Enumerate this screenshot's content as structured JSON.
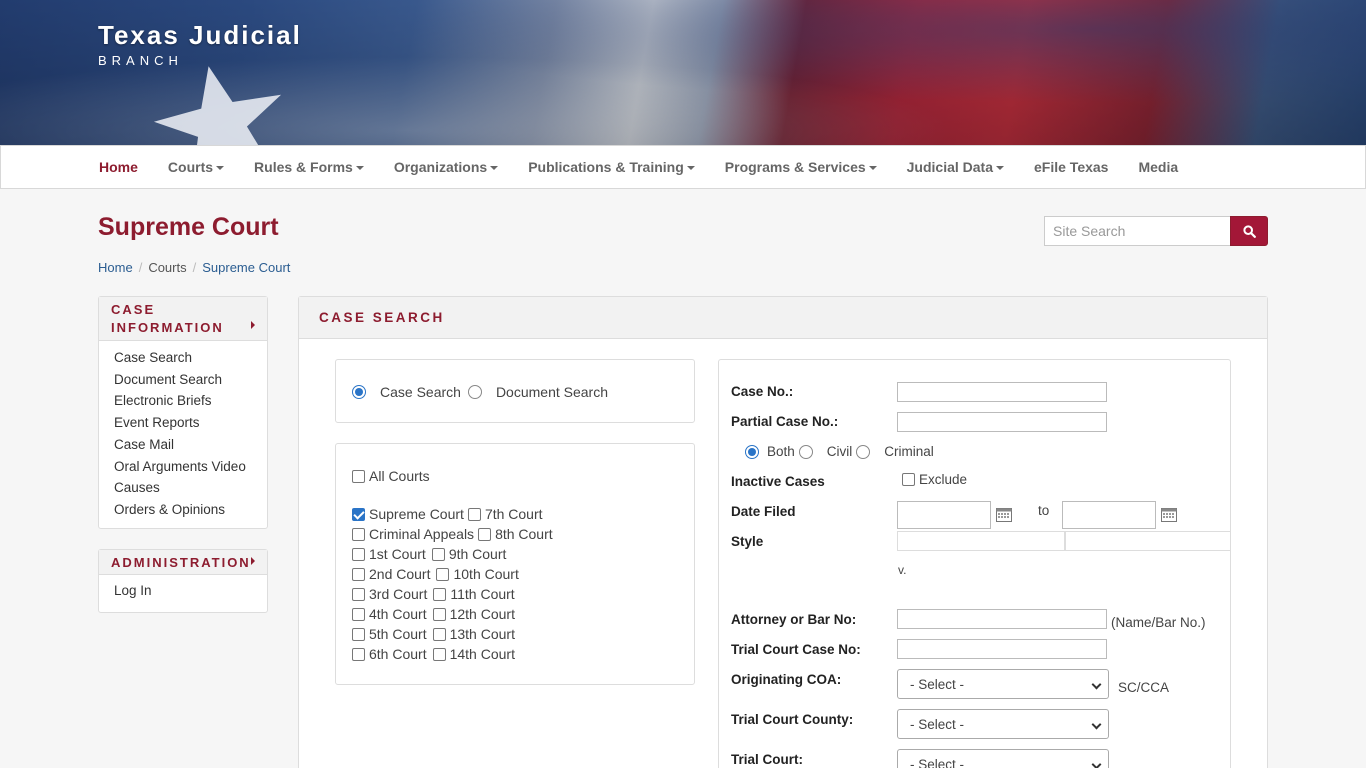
{
  "header": {
    "brand_title": "Texas Judicial",
    "brand_subtitle": "BRANCH"
  },
  "nav": {
    "items": [
      {
        "label": "Home",
        "active": true,
        "dropdown": false
      },
      {
        "label": "Courts",
        "dropdown": true
      },
      {
        "label": "Rules & Forms",
        "dropdown": true
      },
      {
        "label": "Organizations",
        "dropdown": true
      },
      {
        "label": "Publications & Training",
        "dropdown": true
      },
      {
        "label": "Programs & Services",
        "dropdown": true
      },
      {
        "label": "Judicial Data",
        "dropdown": true
      },
      {
        "label": "eFile Texas",
        "dropdown": false
      },
      {
        "label": "Media",
        "dropdown": false
      }
    ]
  },
  "page": {
    "title": "Supreme Court"
  },
  "site_search": {
    "placeholder": "Site Search"
  },
  "breadcrumb": {
    "home": "Home",
    "courts": "Courts",
    "current": "Supreme Court"
  },
  "sidebar": {
    "case_info": {
      "heading_line1": "CASE",
      "heading_line2": "INFORMATION",
      "items": [
        "Case Search",
        "Document Search",
        "Electronic Briefs",
        "Event Reports",
        "Case Mail",
        "Oral Arguments Video",
        "Causes",
        "Orders & Opinions"
      ]
    },
    "admin": {
      "heading": "ADMINISTRATION",
      "items": [
        "Log In"
      ]
    }
  },
  "panel": {
    "heading": "CASE SEARCH"
  },
  "search_type": {
    "case_search": "Case Search",
    "document_search": "Document Search"
  },
  "courts": {
    "all_courts": "All Courts",
    "rows": [
      [
        "Supreme Court",
        "7th Court"
      ],
      [
        "Criminal Appeals",
        "8th Court"
      ],
      [
        "1st Court",
        "9th Court"
      ],
      [
        "2nd Court",
        "10th Court"
      ],
      [
        "3rd Court",
        "11th Court"
      ],
      [
        "4th Court",
        "12th Court"
      ],
      [
        "5th Court",
        "13th Court"
      ],
      [
        "6th Court",
        "14th Court"
      ]
    ]
  },
  "form": {
    "case_no": "Case No.:",
    "partial_case_no": "Partial Case No.:",
    "both": "Both",
    "civil": "Civil",
    "criminal": "Criminal",
    "inactive_cases": "Inactive Cases",
    "exclude": "Exclude",
    "date_filed": "Date Filed",
    "to": "to",
    "style": "Style",
    "versus": "v.",
    "attorney": "Attorney or Bar No:",
    "name_bar_hint": "(Name/Bar No.)",
    "trial_case_no": "Trial Court Case No:",
    "originating_coa": "Originating COA:",
    "sc_cca": "SC/CCA",
    "trial_county": "Trial Court County:",
    "trial_court": "Trial Court:",
    "select_placeholder": "- Select -"
  }
}
